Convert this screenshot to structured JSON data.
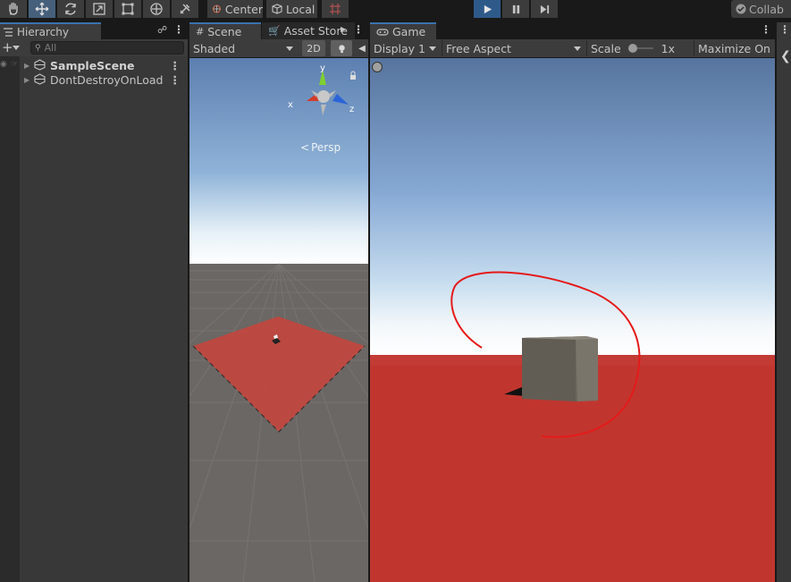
{
  "toolbar": {
    "tools": [
      {
        "name": "hand-tool",
        "icon": "hand-icon"
      },
      {
        "name": "move-tool",
        "icon": "move-icon",
        "active": true
      },
      {
        "name": "rotate-tool",
        "icon": "rotate-icon"
      },
      {
        "name": "scale-tool",
        "icon": "scale-icon"
      },
      {
        "name": "rect-tool",
        "icon": "rect-icon"
      },
      {
        "name": "transform-tool",
        "icon": "transform-icon"
      },
      {
        "name": "custom-tool",
        "icon": "tools-icon"
      }
    ],
    "pivot_label": "Center",
    "space_label": "Local",
    "snap_icon": "grid-snap-icon",
    "play_icon": "play-icon",
    "pause_icon": "pause-icon",
    "step_icon": "step-icon",
    "collab_label": "Collab"
  },
  "hierarchy": {
    "tab_label": "Hierarchy",
    "search_placeholder": "All",
    "items": [
      {
        "label": "SampleScene",
        "bold": true
      },
      {
        "label": "DontDestroyOnLoad",
        "bold": false
      }
    ]
  },
  "scene": {
    "tabs": [
      {
        "label": "Scene",
        "icon": "grid-icon"
      },
      {
        "label": "Asset Store",
        "icon": "store-icon"
      }
    ],
    "shading_mode": "Shaded",
    "mode_2d_label": "2D",
    "gizmo": {
      "y": "y",
      "x": "x",
      "z": "z"
    },
    "projection_label": "Persp"
  },
  "game": {
    "tab_label": "Game",
    "display_label": "Display 1",
    "aspect_label": "Free Aspect",
    "scale_label": "Scale",
    "scale_value": "1x",
    "maximize_label": "Maximize On Pl"
  },
  "colors": {
    "accent": "#3a72b0",
    "ground_red": "#c0302a",
    "annotation_red": "#e51a1a",
    "cube": "#6b665c"
  }
}
